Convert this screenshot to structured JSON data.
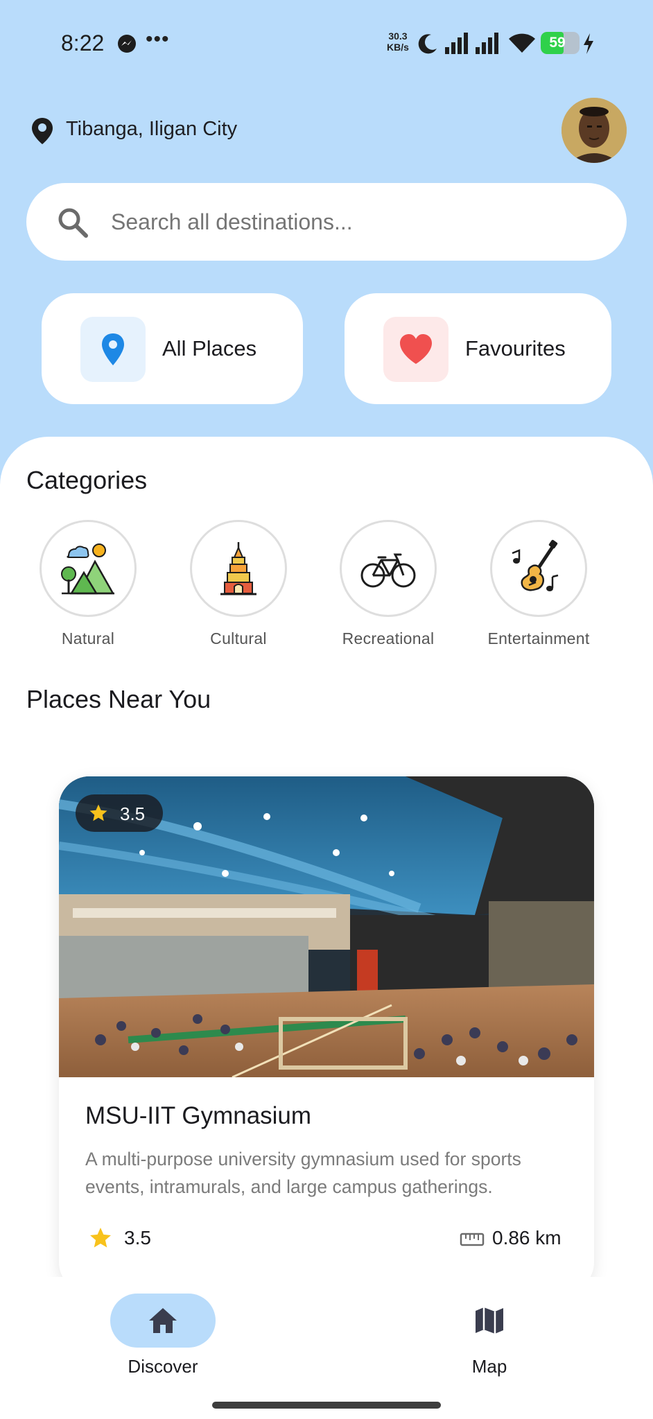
{
  "status_bar": {
    "time": "8:22",
    "net_speed_value": "30.3",
    "net_speed_unit": "KB/s",
    "battery": "59",
    "battery_level": 0.59,
    "icons": [
      "messenger-icon",
      "more-dots-icon",
      "moon-icon",
      "signal-icon",
      "signal-icon",
      "wifi-icon",
      "battery-icon",
      "charging-bolt-icon"
    ]
  },
  "header": {
    "location": "Tibanga, Iligan City",
    "location_icon": "location-pin-icon",
    "avatar": "user-avatar"
  },
  "search": {
    "placeholder": "Search all destinations...",
    "icon": "search-icon"
  },
  "quick_actions": [
    {
      "label": "All Places",
      "icon": "map-pin-icon",
      "icon_color": "#1e88e5",
      "bg": "#e6f2fd"
    },
    {
      "label": "Favourites",
      "icon": "heart-icon",
      "icon_color": "#f0504f",
      "bg": "#fde9e9"
    }
  ],
  "categories": {
    "title": "Categories",
    "items": [
      {
        "label": "Natural",
        "icon": "mountain-tree-icon"
      },
      {
        "label": "Cultural",
        "icon": "pagoda-icon"
      },
      {
        "label": "Recreational",
        "icon": "bicycle-icon"
      },
      {
        "label": "Entertainment",
        "icon": "guitar-music-icon"
      }
    ]
  },
  "places_near_you": {
    "title": "Places Near You",
    "cards": [
      {
        "title": "MSU-IIT Gymnasium",
        "description": "A multi-purpose university gymnasium used for sports events, intramurals, and large campus gatherings.",
        "rating": "3.5",
        "distance": "0.86 km",
        "image": "gymnasium-photo"
      }
    ]
  },
  "bottom_nav": {
    "items": [
      {
        "label": "Discover",
        "icon": "home-icon",
        "active": true
      },
      {
        "label": "Map",
        "icon": "map-icon",
        "active": false
      }
    ]
  },
  "colors": {
    "header_bg": "#b9dcfb",
    "star": "#f8c21c",
    "active_nav": "#b9dcfb"
  }
}
